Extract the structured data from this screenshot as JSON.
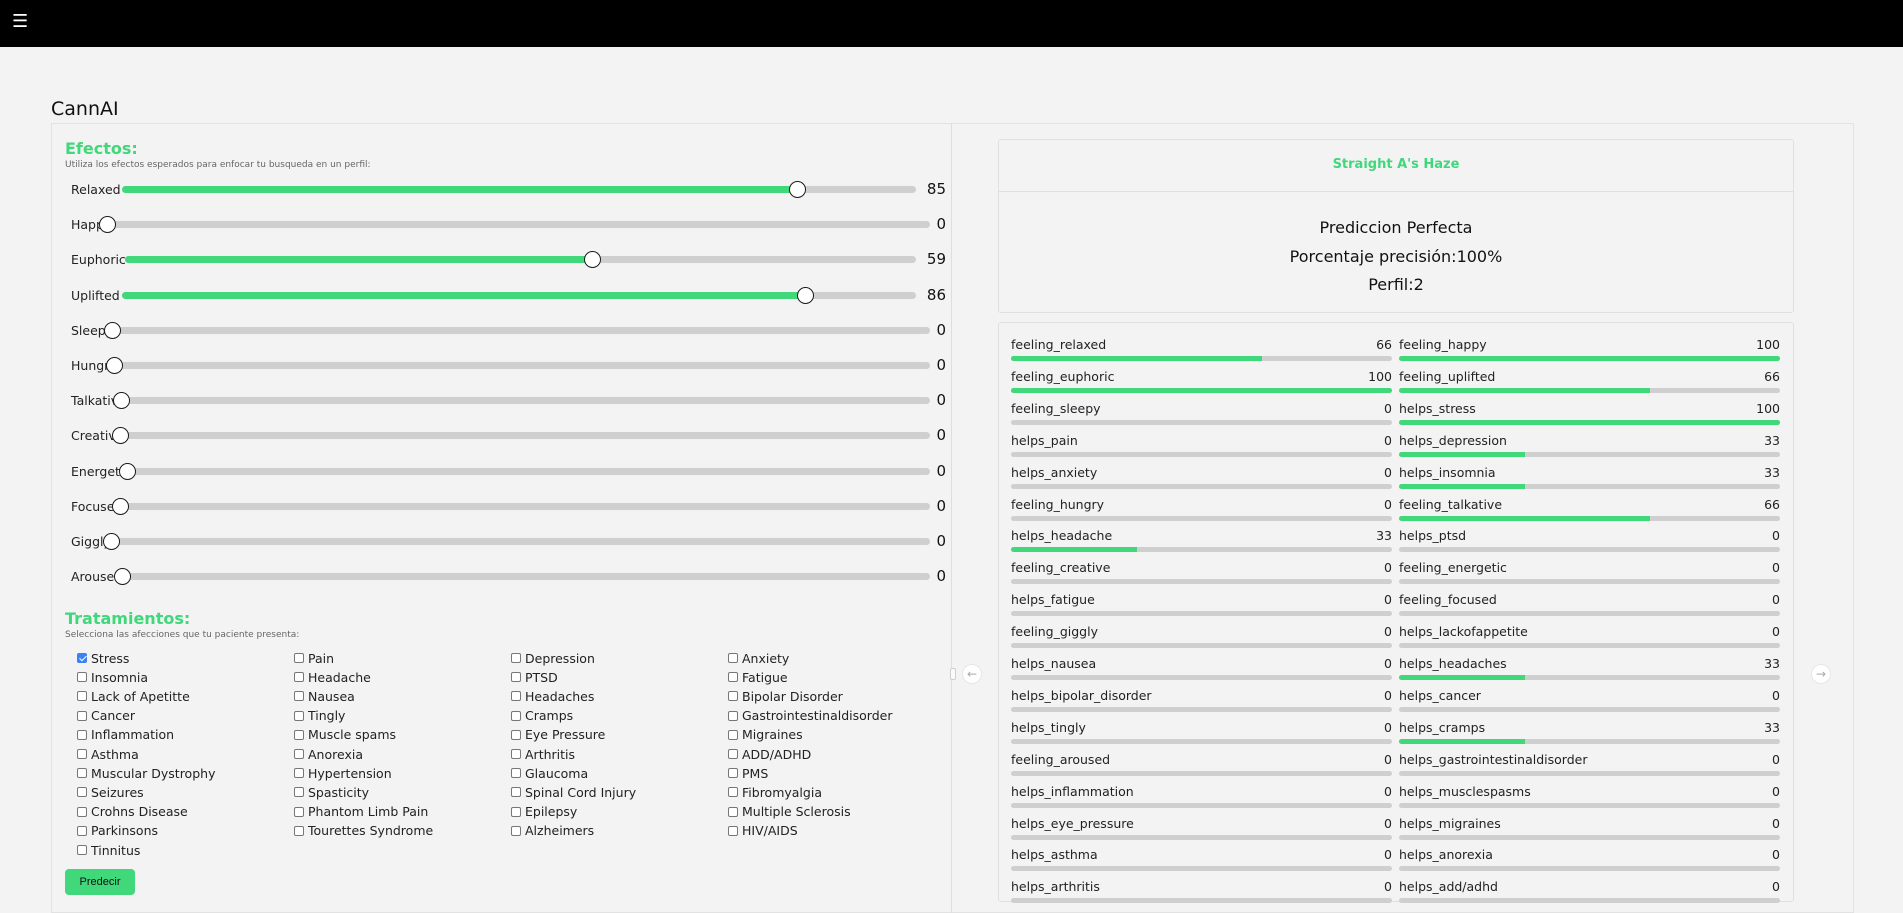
{
  "topbar": {
    "menu_icon": "☰"
  },
  "app": {
    "title": "CannAI"
  },
  "effects": {
    "title": "Efectos:",
    "subtitle": "Utiliza los efectos esperados para enfocar tu busqueda en un perfil:",
    "sliders": [
      {
        "label": "Relaxed",
        "value": 85
      },
      {
        "label": "Happy",
        "value": 0
      },
      {
        "label": "Euphoric",
        "value": 59
      },
      {
        "label": "Uplifted",
        "value": 86
      },
      {
        "label": "Sleepy",
        "value": 0
      },
      {
        "label": "Hungry",
        "value": 0
      },
      {
        "label": "Talkative",
        "value": 0
      },
      {
        "label": "Creative",
        "value": 0
      },
      {
        "label": "Energetic",
        "value": 0
      },
      {
        "label": "Focused",
        "value": 0
      },
      {
        "label": "Giggly",
        "value": 0
      },
      {
        "label": "Aroused",
        "value": 0
      }
    ]
  },
  "treatments": {
    "title": "Tratamientos:",
    "subtitle": "Selecciona las afecciones que tu paciente presenta:",
    "items": [
      {
        "label": "Stress",
        "checked": true
      },
      {
        "label": "Pain",
        "checked": false
      },
      {
        "label": "Depression",
        "checked": false
      },
      {
        "label": "Anxiety",
        "checked": false
      },
      {
        "label": "Insomnia",
        "checked": false
      },
      {
        "label": "Headache",
        "checked": false
      },
      {
        "label": "PTSD",
        "checked": false
      },
      {
        "label": "Fatigue",
        "checked": false
      },
      {
        "label": "Lack of Apetitte",
        "checked": false
      },
      {
        "label": "Nausea",
        "checked": false
      },
      {
        "label": "Headaches",
        "checked": false
      },
      {
        "label": "Bipolar Disorder",
        "checked": false
      },
      {
        "label": "Cancer",
        "checked": false
      },
      {
        "label": "Tingly",
        "checked": false
      },
      {
        "label": "Cramps",
        "checked": false
      },
      {
        "label": "Gastrointestinaldisorder",
        "checked": false
      },
      {
        "label": "Inflammation",
        "checked": false
      },
      {
        "label": "Muscle spams",
        "checked": false
      },
      {
        "label": "Eye Pressure",
        "checked": false
      },
      {
        "label": "Migraines",
        "checked": false
      },
      {
        "label": "Asthma",
        "checked": false
      },
      {
        "label": "Anorexia",
        "checked": false
      },
      {
        "label": "Arthritis",
        "checked": false
      },
      {
        "label": "ADD/ADHD",
        "checked": false
      },
      {
        "label": "Muscular Dystrophy",
        "checked": false
      },
      {
        "label": "Hypertension",
        "checked": false
      },
      {
        "label": "Glaucoma",
        "checked": false
      },
      {
        "label": "PMS",
        "checked": false
      },
      {
        "label": "Seizures",
        "checked": false
      },
      {
        "label": "Spasticity",
        "checked": false
      },
      {
        "label": "Spinal Cord Injury",
        "checked": false
      },
      {
        "label": "Fibromyalgia",
        "checked": false
      },
      {
        "label": "Crohns Disease",
        "checked": false
      },
      {
        "label": "Phantom Limb Pain",
        "checked": false
      },
      {
        "label": "Epilepsy",
        "checked": false
      },
      {
        "label": "Multiple Sclerosis",
        "checked": false
      },
      {
        "label": "Parkinsons",
        "checked": false
      },
      {
        "label": "Tourettes Syndrome",
        "checked": false
      },
      {
        "label": "Alzheimers",
        "checked": false
      },
      {
        "label": "HIV/AIDS",
        "checked": false
      },
      {
        "label": "Tinnitus",
        "checked": false
      }
    ],
    "predict_label": "Predecir"
  },
  "prediction": {
    "strain": "Straight A's Haze",
    "line1": "Prediccion Perfecta",
    "line2": "Porcentaje precisión:100%",
    "line3": "Perfil:2"
  },
  "stats": [
    {
      "label": "feeling_relaxed",
      "value": 66
    },
    {
      "label": "feeling_happy",
      "value": 100
    },
    {
      "label": "feeling_euphoric",
      "value": 100
    },
    {
      "label": "feeling_uplifted",
      "value": 66
    },
    {
      "label": "feeling_sleepy",
      "value": 0
    },
    {
      "label": "helps_stress",
      "value": 100
    },
    {
      "label": "helps_pain",
      "value": 0
    },
    {
      "label": "helps_depression",
      "value": 33
    },
    {
      "label": "helps_anxiety",
      "value": 0
    },
    {
      "label": "helps_insomnia",
      "value": 33
    },
    {
      "label": "feeling_hungry",
      "value": 0
    },
    {
      "label": "feeling_talkative",
      "value": 66
    },
    {
      "label": "helps_headache",
      "value": 33
    },
    {
      "label": "helps_ptsd",
      "value": 0
    },
    {
      "label": "feeling_creative",
      "value": 0
    },
    {
      "label": "feeling_energetic",
      "value": 0
    },
    {
      "label": "helps_fatigue",
      "value": 0
    },
    {
      "label": "feeling_focused",
      "value": 0
    },
    {
      "label": "feeling_giggly",
      "value": 0
    },
    {
      "label": "helps_lackofappetite",
      "value": 0
    },
    {
      "label": "helps_nausea",
      "value": 0
    },
    {
      "label": "helps_headaches",
      "value": 33
    },
    {
      "label": "helps_bipolar_disorder",
      "value": 0
    },
    {
      "label": "helps_cancer",
      "value": 0
    },
    {
      "label": "helps_tingly",
      "value": 0
    },
    {
      "label": "helps_cramps",
      "value": 33
    },
    {
      "label": "feeling_aroused",
      "value": 0
    },
    {
      "label": "helps_gastrointestinaldisorder",
      "value": 0
    },
    {
      "label": "helps_inflammation",
      "value": 0
    },
    {
      "label": "helps_musclespasms",
      "value": 0
    },
    {
      "label": "helps_eye_pressure",
      "value": 0
    },
    {
      "label": "helps_migraines",
      "value": 0
    },
    {
      "label": "helps_asthma",
      "value": 0
    },
    {
      "label": "helps_anorexia",
      "value": 0
    },
    {
      "label": "helps_arthritis",
      "value": 0
    },
    {
      "label": "helps_add/adhd",
      "value": 0
    }
  ],
  "carousel": {
    "prev_icon": "←",
    "next_icon": "→"
  },
  "colors": {
    "accent": "#41d77b",
    "track": "#cfcfcf",
    "topbar": "#000000"
  }
}
